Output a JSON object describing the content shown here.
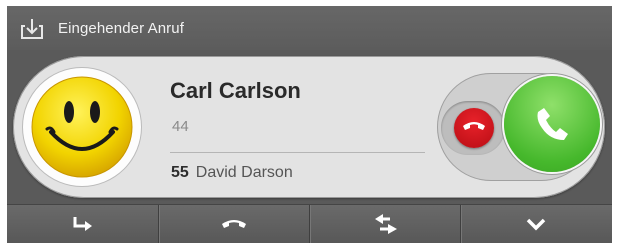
{
  "title": {
    "text": "Eingehender Anruf",
    "icon": "download-tray-icon"
  },
  "call": {
    "caller_name": "Carl Carlson",
    "caller_number": "44",
    "target_extension": "55",
    "target_name": "David Darson",
    "avatar": "smiley-face-icon"
  },
  "buttons": {
    "decline": "hangup-phone-icon",
    "accept": "phone-handset-icon"
  },
  "actions": [
    {
      "icon": "forward-arrow-icon"
    },
    {
      "icon": "phone-handset-icon"
    },
    {
      "icon": "transfer-arrows-icon"
    },
    {
      "icon": "chevron-down-icon"
    }
  ],
  "colors": {
    "decline": "#d4141c",
    "accept": "#4cbb30",
    "smiley": "#f2d400"
  }
}
